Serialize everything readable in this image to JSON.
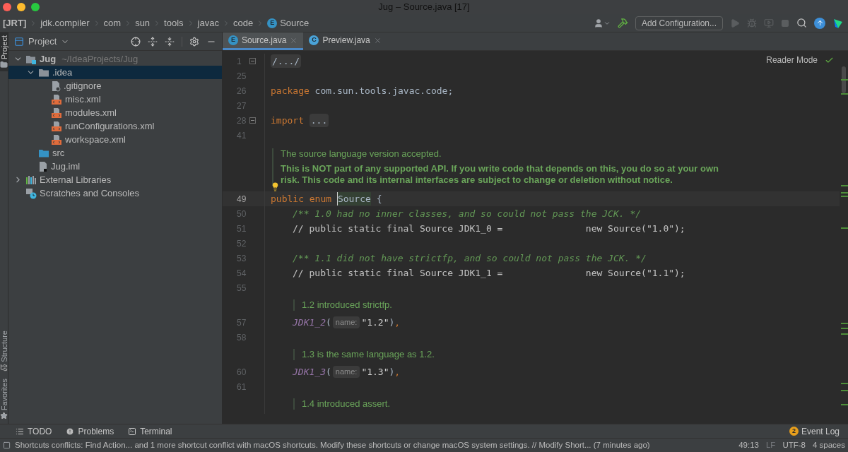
{
  "window": {
    "title": "Jug – Source.java [17]"
  },
  "breadcrumbs": [
    {
      "label": "[JRT]",
      "kind": "plain"
    },
    {
      "label": "jdk.compiler",
      "kind": "plain"
    },
    {
      "label": "com",
      "kind": "plain"
    },
    {
      "label": "sun",
      "kind": "plain"
    },
    {
      "label": "tools",
      "kind": "plain"
    },
    {
      "label": "javac",
      "kind": "plain"
    },
    {
      "label": "code",
      "kind": "plain"
    },
    {
      "label": "Source",
      "kind": "enum",
      "badge": "E"
    }
  ],
  "toolbar": {
    "configuration": "Add Configuration..."
  },
  "tool_stripe": [
    {
      "label": "Project",
      "selected": true,
      "kind": "project"
    },
    {
      "label": "Structure",
      "selected": false,
      "kind": "structure"
    },
    {
      "label": "Favorites",
      "selected": false,
      "kind": "favorites"
    }
  ],
  "project_panel": {
    "title": "Project",
    "tree": [
      {
        "label": "Jug",
        "hint": "~/IdeaProjects/Jug",
        "kind": "module",
        "expanded": true,
        "selected": false,
        "children": [
          {
            "label": ".idea",
            "kind": "folder",
            "expanded": true,
            "selected": true,
            "children": [
              {
                "label": ".gitignore",
                "kind": "gitignore",
                "selected": false
              },
              {
                "label": "misc.xml",
                "kind": "xml",
                "selected": false
              },
              {
                "label": "modules.xml",
                "kind": "xml",
                "selected": false
              },
              {
                "label": "runConfigurations.xml",
                "kind": "xml",
                "selected": false
              },
              {
                "label": "workspace.xml",
                "kind": "xml",
                "selected": false
              }
            ]
          },
          {
            "label": "src",
            "kind": "source-folder",
            "selected": false
          },
          {
            "label": "Jug.iml",
            "kind": "iml",
            "selected": false
          }
        ]
      },
      {
        "label": "External Libraries",
        "kind": "libraries",
        "expanded": false,
        "selected": false
      },
      {
        "label": "Scratches and Consoles",
        "kind": "scratches",
        "selected": false
      }
    ]
  },
  "tabs": [
    {
      "label": "Source.java",
      "badge": "E",
      "kind": "enum",
      "selected": true
    },
    {
      "label": "Preview.java",
      "badge": "C",
      "kind": "class",
      "selected": false
    }
  ],
  "editor": {
    "reader_mode": "Reader Mode",
    "lines": [
      {
        "kind": "code",
        "number": "1",
        "current": false,
        "folded": true,
        "tokens": [
          {
            "kind": "folded",
            "text": "/.../"
          }
        ]
      },
      {
        "kind": "code",
        "number": "25",
        "current": false,
        "folded": false
      },
      {
        "kind": "code",
        "number": "26",
        "current": false,
        "folded": false,
        "tokens": [
          {
            "kind": "keyword",
            "text": "package"
          },
          {
            "kind": "plain",
            "text": "com.sun.tools.javac.code;"
          }
        ]
      },
      {
        "kind": "code",
        "number": "27",
        "current": false,
        "folded": false
      },
      {
        "kind": "code",
        "number": "28",
        "current": false,
        "folded": true,
        "tokens": [
          {
            "kind": "keyword",
            "text": "import"
          },
          {
            "kind": "folded",
            "text": "..."
          }
        ]
      },
      {
        "kind": "code",
        "number": "41",
        "current": false,
        "folded": false
      },
      {
        "kind": "doc",
        "intention": true,
        "paragraphs": [
          {
            "text": "The source language version accepted.",
            "strong": false
          },
          {
            "text": "This is NOT part of any supported API. If you write code that depends on this, you do so at your own risk. This code and its internal interfaces are subject to change or deletion without notice.",
            "strong": true
          }
        ]
      },
      {
        "kind": "code",
        "number": "49",
        "current": true,
        "folded": false,
        "tokens": [
          {
            "kind": "keyword",
            "text": "public"
          },
          {
            "kind": "keyword",
            "text": "enum"
          },
          {
            "kind": "caret",
            "text": "Source"
          },
          {
            "kind": "plain",
            "text": "{"
          }
        ]
      },
      {
        "kind": "member-code",
        "number": "50",
        "current": false,
        "folded": false,
        "tokens": [
          {
            "kind": "doc-comment",
            "text": "/** 1.0 had no inner classes, and so could not pass the JCK. */"
          }
        ]
      },
      {
        "kind": "member-code",
        "number": "51",
        "current": false,
        "folded": false,
        "tokens": [
          {
            "kind": "comment",
            "text": "// public static final Source JDK1_0 =               new Source(\"1.0\");"
          }
        ]
      },
      {
        "kind": "code",
        "number": "52",
        "current": false,
        "folded": false
      },
      {
        "kind": "member-code",
        "number": "53",
        "current": false,
        "folded": false,
        "tokens": [
          {
            "kind": "doc-comment",
            "text": "/** 1.1 did not have strictfp, and so could not pass the JCK. */"
          }
        ]
      },
      {
        "kind": "member-code",
        "number": "54",
        "current": false,
        "folded": false,
        "tokens": [
          {
            "kind": "comment",
            "text": "// public static final Source JDK1_1 =               new Source(\"1.1\");"
          }
        ]
      },
      {
        "kind": "code",
        "number": "55",
        "current": false,
        "folded": false
      },
      {
        "kind": "member-doc",
        "intention": false,
        "paragraphs": [
          {
            "text": "1.2 introduced strictfp.",
            "strong": false
          }
        ]
      },
      {
        "kind": "member-code",
        "number": "57",
        "current": false,
        "folded": false,
        "tokens": [
          {
            "kind": "constant",
            "text": "JDK1_2"
          },
          {
            "kind": "plain",
            "text": "("
          },
          {
            "kind": "hint",
            "text": "name:"
          },
          {
            "kind": "string",
            "text": "\"1.2\""
          },
          {
            "kind": "plain",
            "text": ")"
          },
          {
            "kind": "punct",
            "text": ","
          }
        ]
      },
      {
        "kind": "code",
        "number": "58",
        "current": false,
        "folded": false
      },
      {
        "kind": "member-doc",
        "intention": false,
        "paragraphs": [
          {
            "text": "1.3 is the same language as 1.2.",
            "strong": false
          }
        ]
      },
      {
        "kind": "member-code",
        "number": "60",
        "current": false,
        "folded": false,
        "tokens": [
          {
            "kind": "constant",
            "text": "JDK1_3"
          },
          {
            "kind": "plain",
            "text": "("
          },
          {
            "kind": "hint",
            "text": "name:"
          },
          {
            "kind": "string",
            "text": "\"1.3\""
          },
          {
            "kind": "plain",
            "text": ")"
          },
          {
            "kind": "punct",
            "text": ","
          }
        ]
      },
      {
        "kind": "code",
        "number": "61",
        "current": false,
        "folded": false
      },
      {
        "kind": "member-doc",
        "intention": false,
        "paragraphs": [
          {
            "text": "1.4 introduced assert.",
            "strong": false
          }
        ]
      }
    ]
  },
  "tool_windows": [
    {
      "label": "TODO",
      "kind": "todo"
    },
    {
      "label": "Problems",
      "kind": "problems"
    },
    {
      "label": "Terminal",
      "kind": "terminal"
    }
  ],
  "event_log": {
    "label": "Event Log",
    "count": "2"
  },
  "status_bar": {
    "message": "Shortcuts conflicts: Find Action... and 1 more shortcut conflict with macOS shortcuts. Modify these shortcuts or change macOS system settings. // Modify Short... (7 minutes ago)",
    "position": "49:13",
    "line_separator": "LF",
    "encoding": "UTF-8",
    "indent": "4 spaces"
  }
}
